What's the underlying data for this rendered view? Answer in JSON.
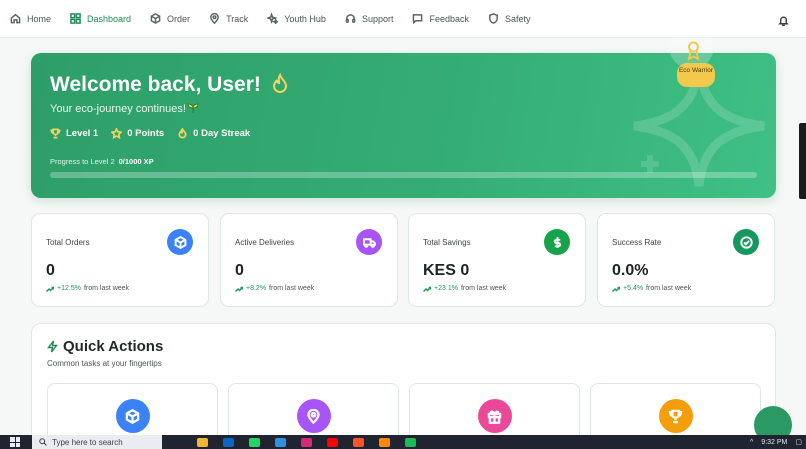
{
  "nav": {
    "items": [
      {
        "label": "Home",
        "icon": "home-icon"
      },
      {
        "label": "Dashboard",
        "icon": "grid-icon",
        "active": true
      },
      {
        "label": "Order",
        "icon": "box-icon"
      },
      {
        "label": "Track",
        "icon": "map-pin-icon"
      },
      {
        "label": "Youth Hub",
        "icon": "sparkles-icon"
      },
      {
        "label": "Support",
        "icon": "headset-icon"
      },
      {
        "label": "Feedback",
        "icon": "message-icon"
      },
      {
        "label": "Safety",
        "icon": "shield-icon"
      }
    ],
    "accent": "#1d8a56"
  },
  "hero": {
    "title": "Welcome back, User!",
    "subtitle": "Your eco-journey continues!",
    "level": "Level 1",
    "points": "0 Points",
    "streak": "0 Day Streak",
    "progress_label": "Progress to Level 2",
    "progress_value": "0/1000 XP",
    "progress_fraction": 0.0,
    "badge_text": "Eco Warrior"
  },
  "stats": [
    {
      "label": "Total Orders",
      "value": "0",
      "trend": "+12.5%",
      "trend_note": "from last week",
      "color": "#3b82f6",
      "icon": "box-icon"
    },
    {
      "label": "Active Deliveries",
      "value": "0",
      "trend": "+8.2%",
      "trend_note": "from last week",
      "color": "#a855f7",
      "icon": "truck-icon"
    },
    {
      "label": "Total Savings",
      "value": "KES 0",
      "trend": "+23.1%",
      "trend_note": "from last week",
      "color": "#16a34a",
      "icon": "dollar-icon"
    },
    {
      "label": "Success Rate",
      "value": "0.0%",
      "trend": "+5.4%",
      "trend_note": "from last week",
      "color": "#15975f",
      "icon": "check-circle-icon"
    }
  ],
  "quick_actions": {
    "title": "Quick Actions",
    "subtitle": "Common tasks at your fingertips",
    "items": [
      {
        "icon": "box-icon",
        "color": "#3b82f6"
      },
      {
        "icon": "map-pin-icon",
        "color": "#a855f7"
      },
      {
        "icon": "gift-icon",
        "color": "#ec4899"
      },
      {
        "icon": "trophy-icon",
        "color": "#f59e0b"
      }
    ]
  },
  "taskbar": {
    "search_placeholder": "Type here to search",
    "time": "9:32 PM"
  }
}
